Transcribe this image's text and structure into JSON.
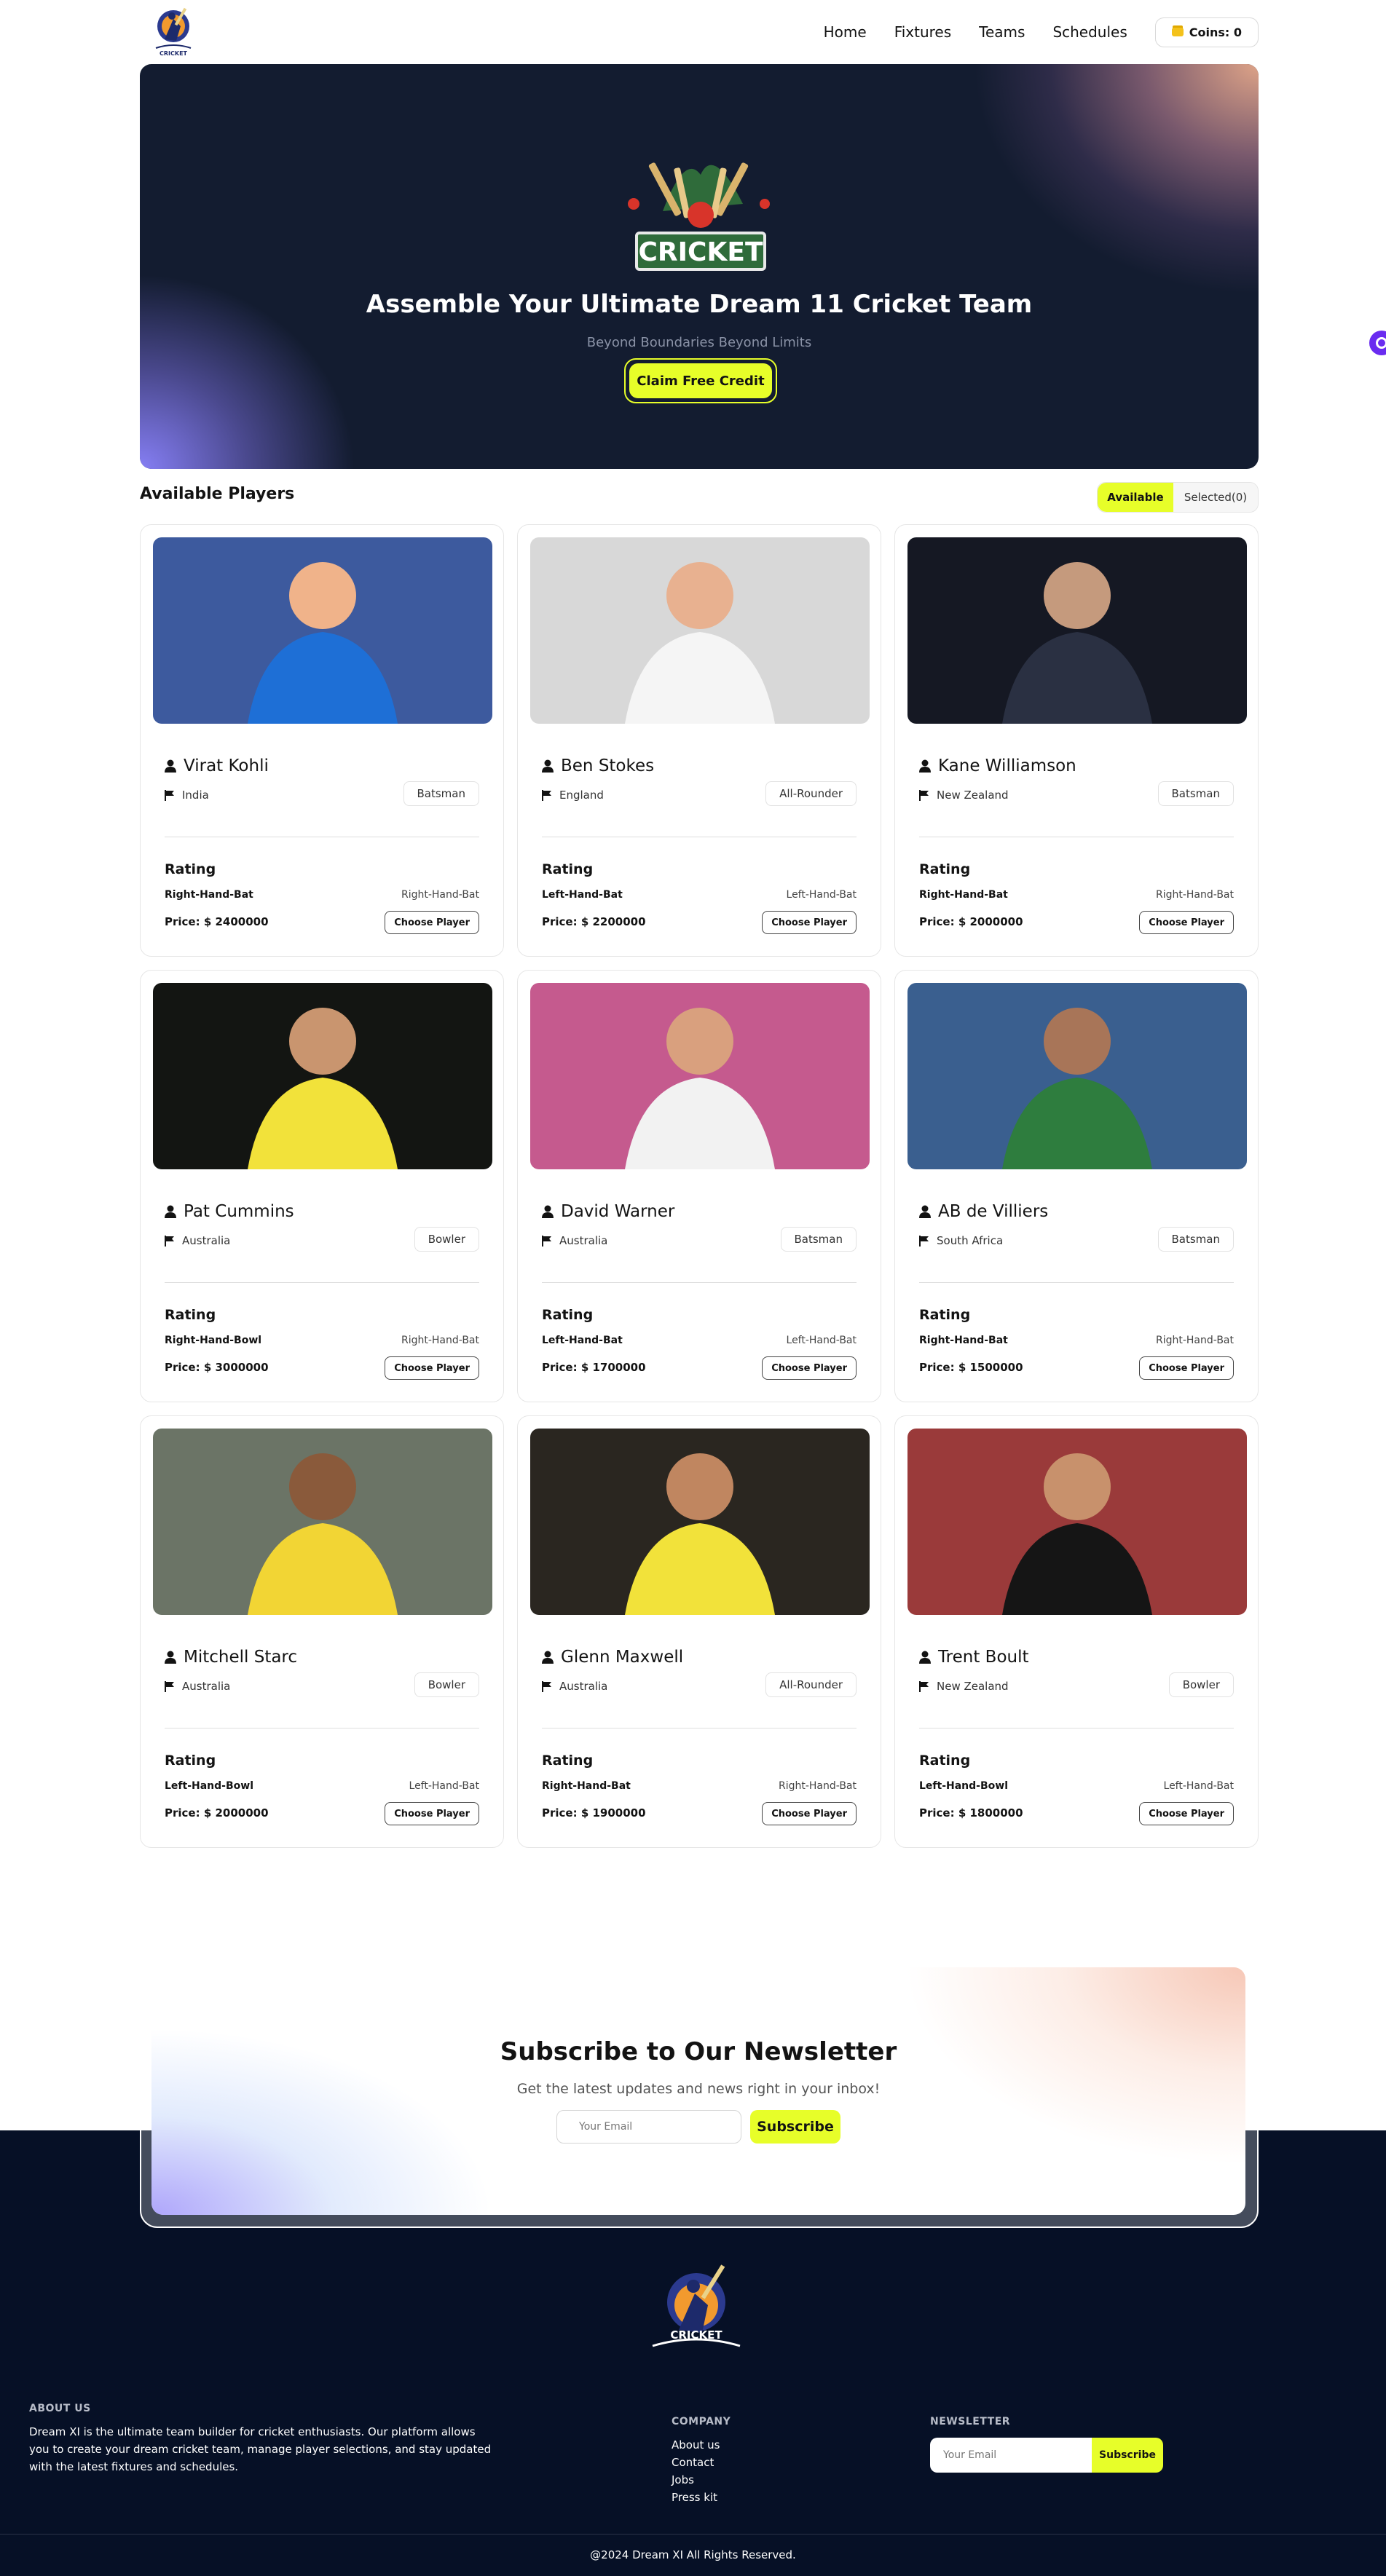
{
  "nav": {
    "links": [
      "Home",
      "Fixtures",
      "Teams",
      "Schedules"
    ],
    "coins_label": "Coins: 0"
  },
  "hero": {
    "logo_text": "CRICKET",
    "title": "Assemble Your Ultimate Dream 11 Cricket Team",
    "subtitle": "Beyond Boundaries Beyond Limits",
    "cta": "Claim Free Credit"
  },
  "players_section": {
    "title": "Available Players",
    "tab_available": "Available",
    "tab_selected": "Selected(0)",
    "rating_label": "Rating",
    "choose_label": "Choose Player",
    "players": [
      {
        "name": "Virat Kohli",
        "country": "India",
        "role": "Batsman",
        "bat": "Right-Hand-Bat",
        "bat2": "Right-Hand-Bat",
        "price": "Price: $ 2400000"
      },
      {
        "name": "Ben Stokes",
        "country": "England",
        "role": "All-Rounder",
        "bat": "Left-Hand-Bat",
        "bat2": "Left-Hand-Bat",
        "price": "Price: $ 2200000"
      },
      {
        "name": "Kane Williamson",
        "country": "New Zealand",
        "role": "Batsman",
        "bat": "Right-Hand-Bat",
        "bat2": "Right-Hand-Bat",
        "price": "Price: $ 2000000"
      },
      {
        "name": "Pat Cummins",
        "country": "Australia",
        "role": "Bowler",
        "bat": "Right-Hand-Bowl",
        "bat2": "Right-Hand-Bat",
        "price": "Price: $ 3000000"
      },
      {
        "name": "David Warner",
        "country": "Australia",
        "role": "Batsman",
        "bat": "Left-Hand-Bat",
        "bat2": "Left-Hand-Bat",
        "price": "Price: $ 1700000"
      },
      {
        "name": "AB de Villiers",
        "country": "South Africa",
        "role": "Batsman",
        "bat": "Right-Hand-Bat",
        "bat2": "Right-Hand-Bat",
        "price": "Price: $ 1500000"
      },
      {
        "name": "Mitchell Starc",
        "country": "Australia",
        "role": "Bowler",
        "bat": "Left-Hand-Bowl",
        "bat2": "Left-Hand-Bat",
        "price": "Price: $ 2000000"
      },
      {
        "name": "Glenn Maxwell",
        "country": "Australia",
        "role": "All-Rounder",
        "bat": "Right-Hand-Bat",
        "bat2": "Right-Hand-Bat",
        "price": "Price: $ 1900000"
      },
      {
        "name": "Trent Boult",
        "country": "New Zealand",
        "role": "Bowler",
        "bat": "Left-Hand-Bowl",
        "bat2": "Left-Hand-Bat",
        "price": "Price: $ 1800000"
      }
    ]
  },
  "newsletter": {
    "title": "Subscribe to Our Newsletter",
    "subtitle": "Get the latest updates and news right in your inbox!",
    "placeholder": "Your Email",
    "button": "Subscribe"
  },
  "footer": {
    "logo_text": "CRICKET",
    "about_title": "ABOUT US",
    "about_text": "Dream XI is the ultimate team builder for cricket enthusiasts. Our platform allows you to create your dream cricket team, manage player selections, and stay updated with the latest fixtures and schedules.",
    "company_title": "COMPANY",
    "company_links": [
      "About us",
      "Contact",
      "Jobs",
      "Press kit"
    ],
    "newsletter_title": "NEWSLETTER",
    "newsletter_placeholder": "Your Email",
    "newsletter_button": "Subscribe",
    "copyright": "@2024 Dream XI All Rights Reserved."
  },
  "colors": {
    "accent": "#e7fe29",
    "dark": "#061026",
    "hero_bg": "#131c30"
  }
}
